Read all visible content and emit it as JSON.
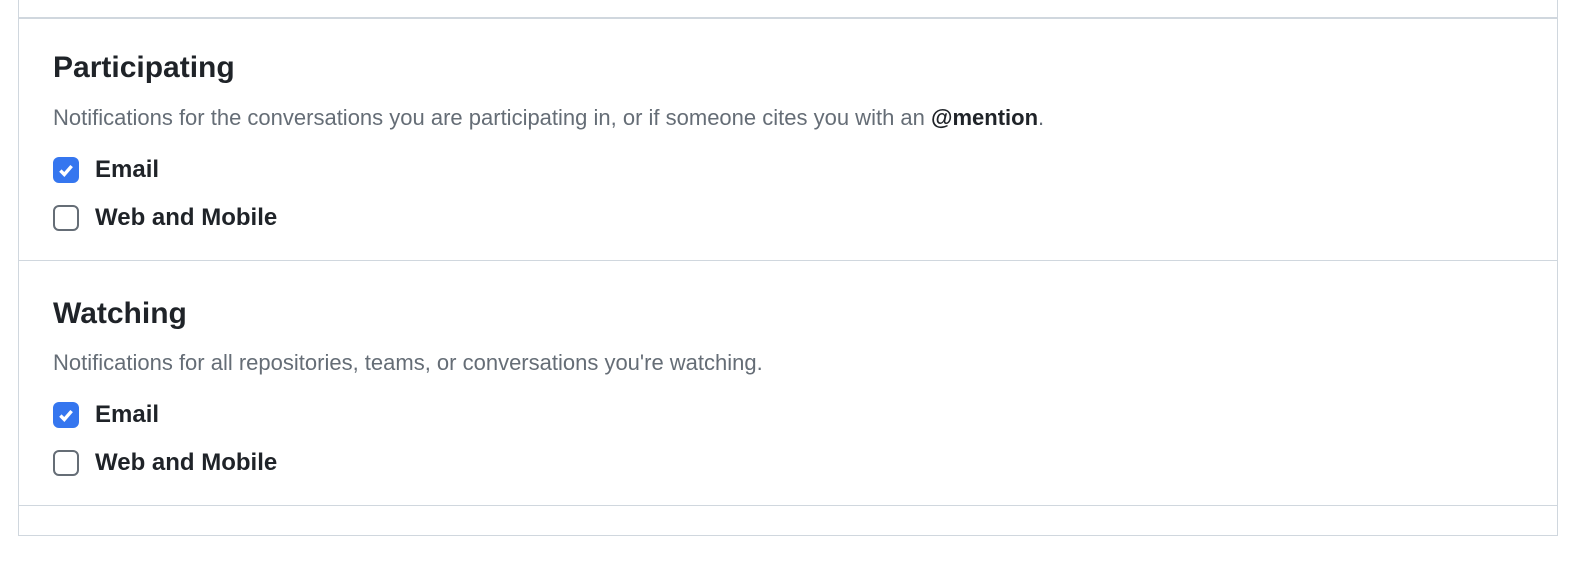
{
  "sections": {
    "participating": {
      "title": "Participating",
      "desc_prefix": "Notifications for the conversations you are participating in, or if someone cites you with an ",
      "desc_bold": "@mention",
      "desc_suffix": ".",
      "options": {
        "email": {
          "label": "Email",
          "checked": true
        },
        "web_mobile": {
          "label": "Web and Mobile",
          "checked": false
        }
      }
    },
    "watching": {
      "title": "Watching",
      "desc": "Notifications for all repositories, teams, or conversations you're watching.",
      "options": {
        "email": {
          "label": "Email",
          "checked": true
        },
        "web_mobile": {
          "label": "Web and Mobile",
          "checked": false
        }
      }
    }
  }
}
